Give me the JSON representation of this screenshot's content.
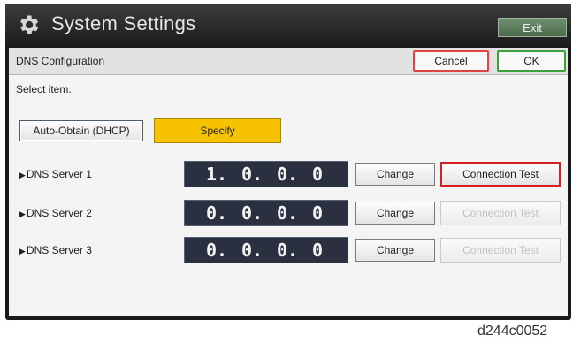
{
  "titlebar": {
    "title": "System Settings",
    "exit_label": "Exit"
  },
  "header": {
    "title": "DNS Configuration",
    "cancel_label": "Cancel",
    "ok_label": "OK"
  },
  "prompt": "Select item.",
  "mode": {
    "auto_label": "Auto-Obtain (DHCP)",
    "specify_label": "Specify",
    "selected": "Specify"
  },
  "servers": [
    {
      "label": "DNS Server 1",
      "octets": [
        "1.",
        "0.",
        "0.",
        "0"
      ],
      "change_label": "Change",
      "test_label": "Connection Test",
      "test_enabled": true
    },
    {
      "label": "DNS Server 2",
      "octets": [
        "0.",
        "0.",
        "0.",
        "0"
      ],
      "change_label": "Change",
      "test_label": "Connection Test",
      "test_enabled": false
    },
    {
      "label": "DNS Server 3",
      "octets": [
        "0.",
        "0.",
        "0.",
        "0"
      ],
      "change_label": "Change",
      "test_label": "Connection Test",
      "test_enabled": false
    }
  ],
  "caption": "d244c0052",
  "colors": {
    "specify_selected": "#f7c300",
    "cancel_border": "#dd4444",
    "ok_border": "#3aa23a",
    "highlight": "#d62020"
  },
  "icons": {
    "title_icon": "gear-icon",
    "row_marker": "triangle-right-icon"
  }
}
